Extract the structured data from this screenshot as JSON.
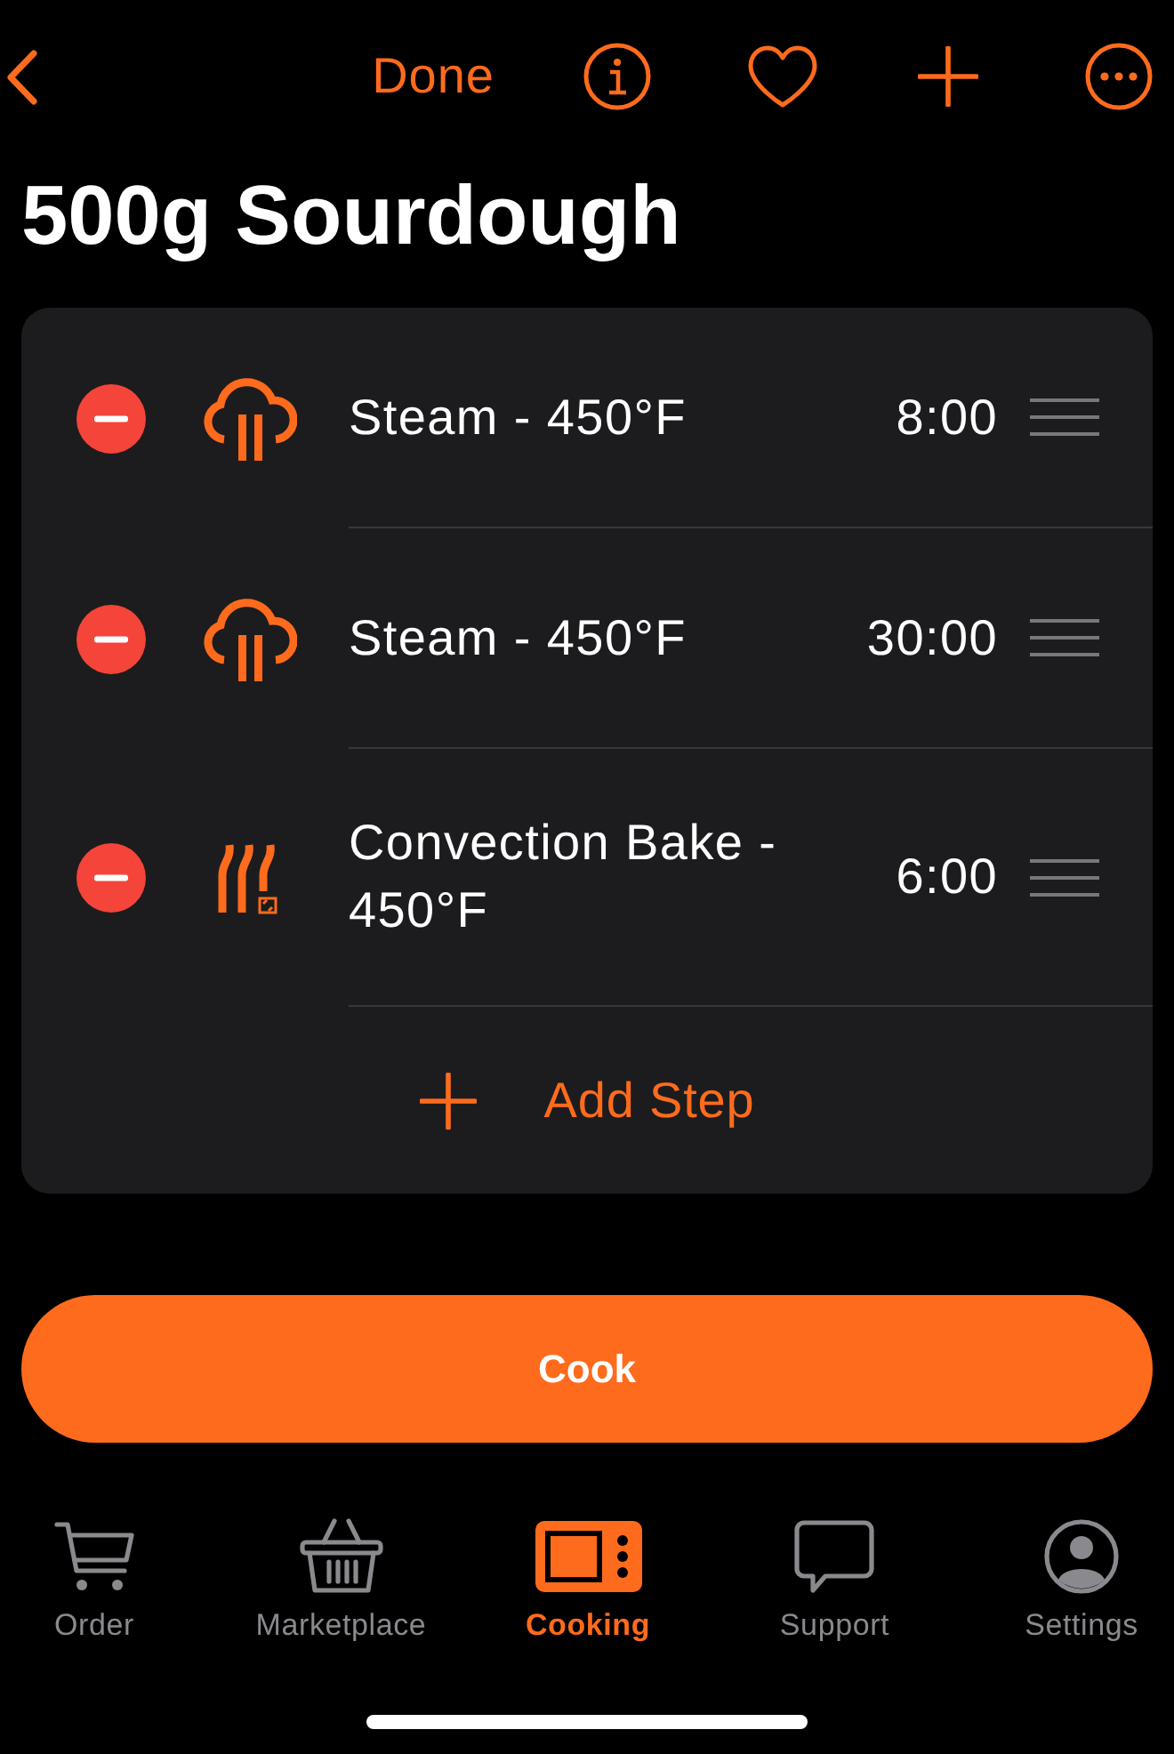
{
  "nav": {
    "done_label": "Done"
  },
  "title": "500g Sourdough",
  "steps": [
    {
      "kind": "steam",
      "name": "Steam - 450°F",
      "time": "8:00"
    },
    {
      "kind": "steam",
      "name": "Steam - 450°F",
      "time": "30:00"
    },
    {
      "kind": "convection",
      "name": "Convection Bake - 450°F",
      "time": "6:00"
    }
  ],
  "add_step": {
    "label": "Add Step"
  },
  "cook_button": {
    "label": "Cook"
  },
  "tabs": [
    {
      "label": "Order",
      "selected": false
    },
    {
      "label": "Marketplace",
      "selected": false
    },
    {
      "label": "Cooking",
      "selected": true
    },
    {
      "label": "Support",
      "selected": false
    },
    {
      "label": "Settings",
      "selected": false
    }
  ]
}
